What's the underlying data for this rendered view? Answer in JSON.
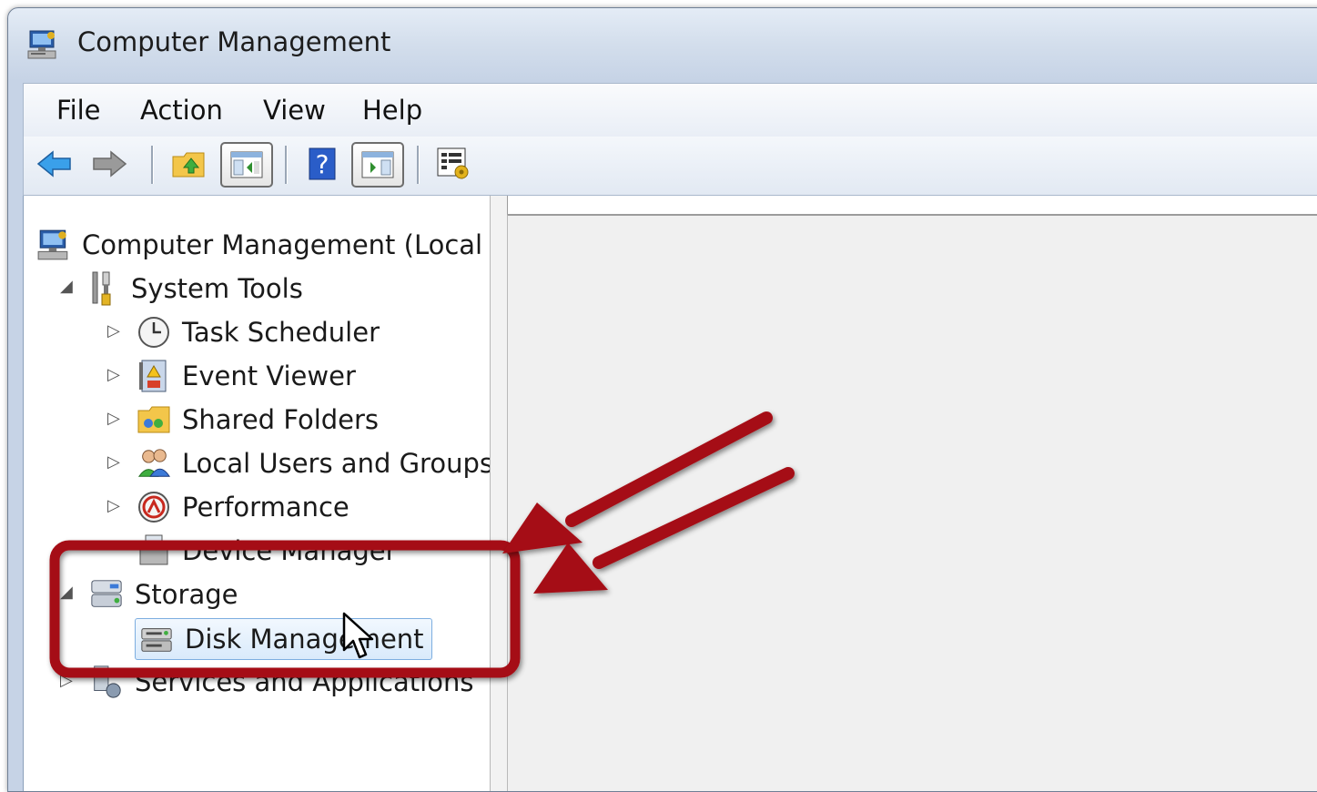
{
  "window": {
    "title": "Computer Management"
  },
  "menu": {
    "file": "File",
    "action": "Action",
    "view": "View",
    "help": "Help"
  },
  "toolbar": {
    "back_icon": "back-arrow-icon",
    "forward_icon": "forward-arrow-icon",
    "up_icon": "up-folder-icon",
    "show_hide_tree_icon": "console-tree-icon",
    "help_icon": "help-icon",
    "show_hide_action_icon": "action-pane-icon",
    "properties_icon": "properties-icon"
  },
  "tree": {
    "root": "Computer Management (Local",
    "system_tools": "System Tools",
    "task_scheduler": "Task Scheduler",
    "event_viewer": "Event Viewer",
    "shared_folders": "Shared Folders",
    "local_users": "Local Users and Groups",
    "performance": "Performance",
    "device_manager": "Device Manager",
    "storage": "Storage",
    "disk_management": "Disk Management",
    "services": "Services and Applications"
  },
  "colors": {
    "annotation": "#a50f14",
    "selection": "#d9eafb",
    "right_pane": "#f0f0f0"
  }
}
